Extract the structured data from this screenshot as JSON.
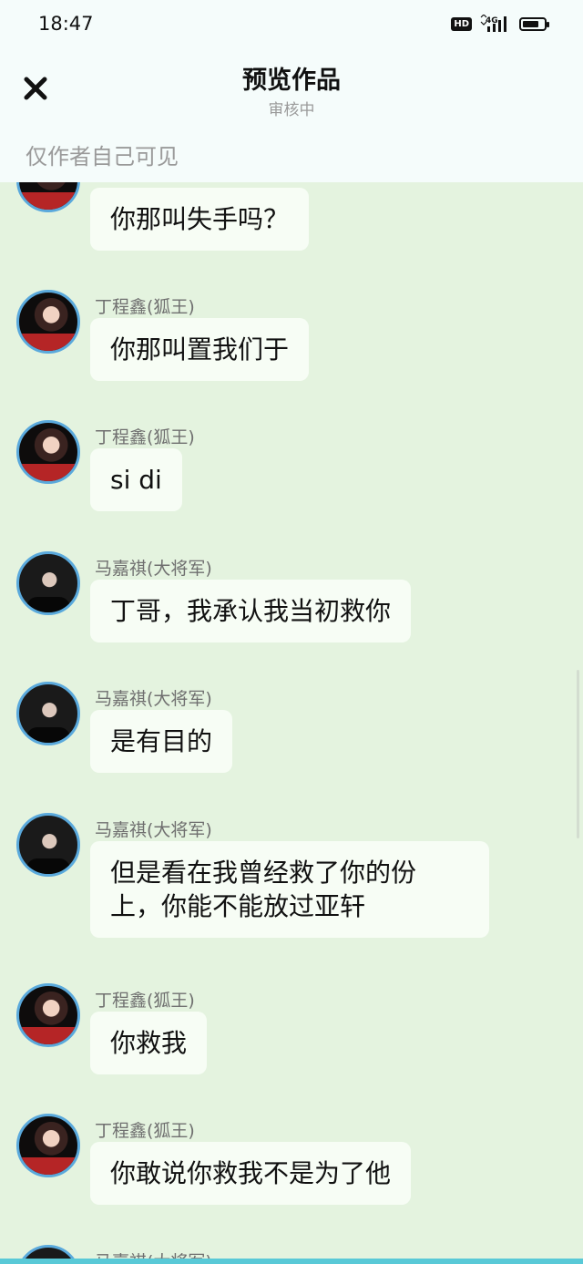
{
  "status_bar": {
    "time": "18:47",
    "hd": "HD",
    "network": "4G",
    "battery_level": 0.75
  },
  "header": {
    "title": "预览作品",
    "subtitle": "审核中",
    "notice": "仅作者自己可见"
  },
  "messages": [
    {
      "name": "",
      "text": "你那叫失手吗？"
    },
    {
      "name": "丁程鑫(狐王)",
      "text": "你那叫置我们于"
    },
    {
      "name": "丁程鑫(狐王)",
      "text": "si di"
    },
    {
      "name": "马嘉祺(大将军)",
      "text": "丁哥，我承认我当初救你"
    },
    {
      "name": "马嘉祺(大将军)",
      "text": "是有目的"
    },
    {
      "name": "马嘉祺(大将军)",
      "text": "但是看在我曾经救了你的份\n上，你能不能放过亚轩"
    },
    {
      "name": "丁程鑫(狐王)",
      "text": "你救我"
    },
    {
      "name": "丁程鑫(狐王)",
      "text": "你敢说你救我不是为了他"
    },
    {
      "name": "马嘉祺(大将军)",
      "text": ""
    }
  ]
}
